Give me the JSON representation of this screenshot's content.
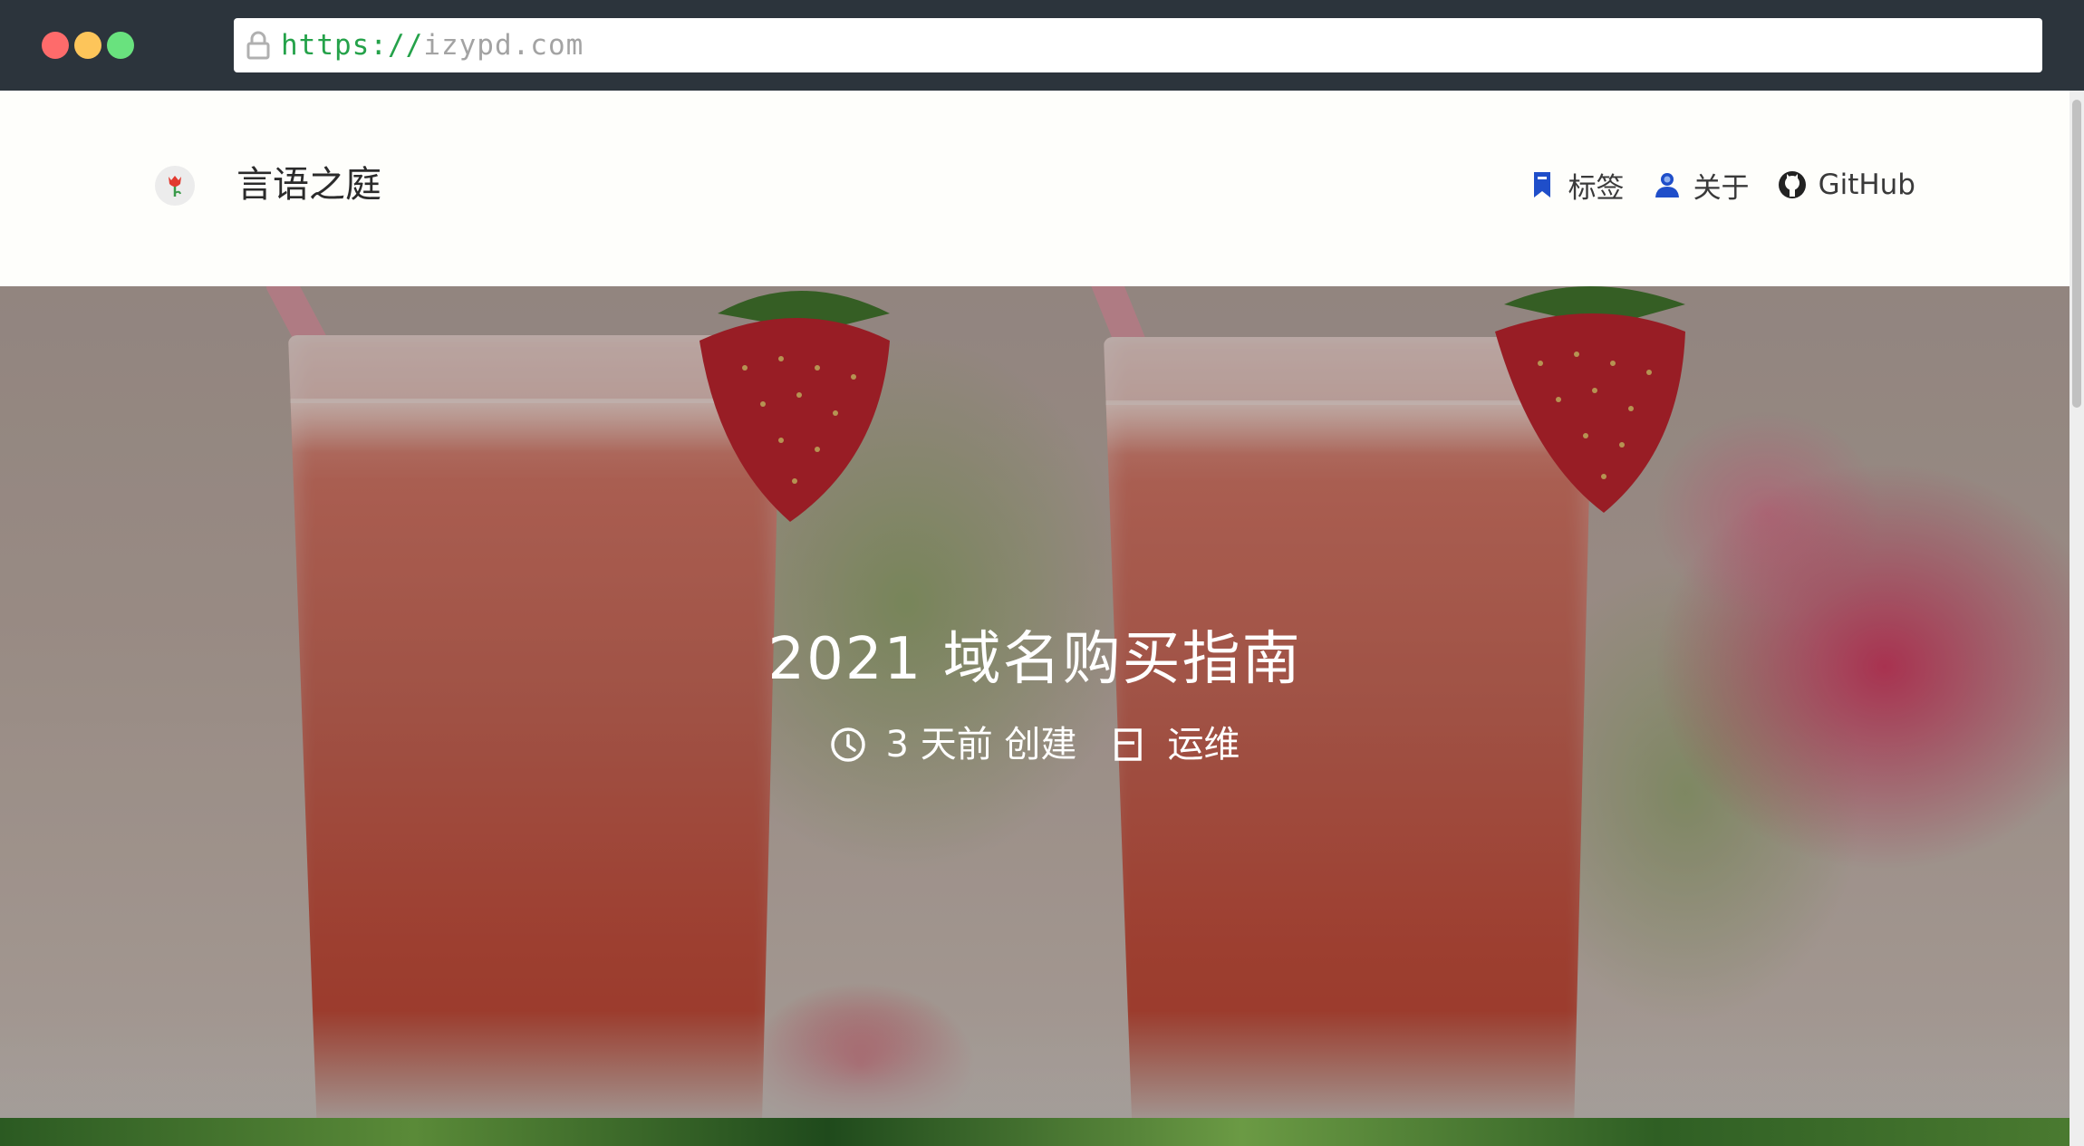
{
  "browser": {
    "url_scheme": "https://",
    "url_host": "izypd.com",
    "icons": {
      "lock": "lock-icon"
    }
  },
  "header": {
    "site_title": "言语之庭",
    "logo_icon": "tulip-logo-icon",
    "nav": [
      {
        "label": "标签",
        "icon": "bookmark-icon"
      },
      {
        "label": "关于",
        "icon": "user-icon"
      },
      {
        "label": "GitHub",
        "icon": "github-icon"
      }
    ]
  },
  "hero": {
    "title": "2021 域名购买指南",
    "created": "3 天前 创建",
    "category": "运维",
    "icons": {
      "time": "clock-icon",
      "category": "folder-icon"
    }
  },
  "colors": {
    "chrome": "#2c343c",
    "url_scheme": "#25a24a",
    "nav_icon": "#1f4ec9",
    "page_bg": "#fefefb"
  }
}
